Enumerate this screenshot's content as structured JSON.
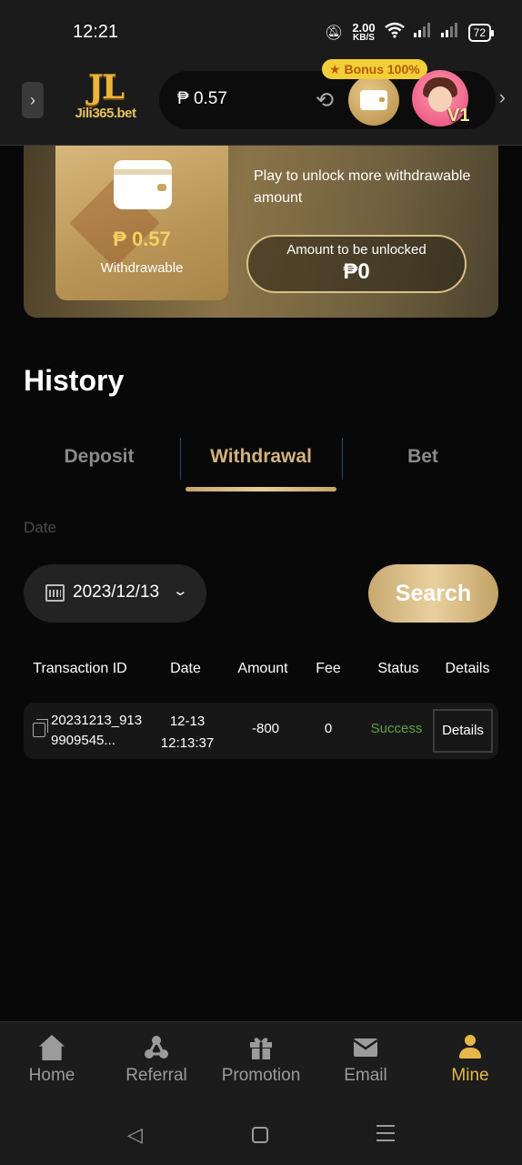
{
  "status_bar": {
    "time": "12:21",
    "net_speed_value": "2.00",
    "net_speed_unit": "KB/S",
    "battery": "72"
  },
  "header": {
    "logo_text": "JL",
    "logo_site": "Jili365.bet",
    "balance": "₱ 0.57",
    "bonus_tag": "Bonus 100%",
    "vip_level": "V1"
  },
  "wallet_card": {
    "withdrawable_amount": "₱ 0.57",
    "withdrawable_label": "Withdrawable",
    "unlock_text": "Play to unlock more withdrawable amount",
    "unlock_label": "Amount to be unlocked",
    "unlock_value": "₱0"
  },
  "history": {
    "title": "History",
    "tabs": [
      {
        "label": "Deposit",
        "active": false
      },
      {
        "label": "Withdrawal",
        "active": true
      },
      {
        "label": "Bet",
        "active": false
      }
    ],
    "date_label": "Date",
    "date_value": "2023/12/13",
    "search_label": "Search",
    "columns": [
      "Transaction ID",
      "Date",
      "Amount",
      "Fee",
      "Status",
      "Details"
    ],
    "rows": [
      {
        "transaction_id": "20231213_9139909545...",
        "date": "12-13 12:13:37",
        "amount": "-800",
        "fee": "0",
        "status": "Success",
        "details": "Details"
      }
    ]
  },
  "bottom_nav": [
    {
      "label": "Home",
      "icon": "home-icon",
      "active": false
    },
    {
      "label": "Referral",
      "icon": "referral-icon",
      "active": false
    },
    {
      "label": "Promotion",
      "icon": "gift-icon",
      "active": false
    },
    {
      "label": "Email",
      "icon": "mail-icon",
      "active": false
    },
    {
      "label": "Mine",
      "icon": "user-icon",
      "active": true
    }
  ],
  "colors": {
    "accent_gold": "#d2b27b",
    "active_nav": "#e6b84a",
    "success": "#5fa33f",
    "background": "#080808"
  }
}
